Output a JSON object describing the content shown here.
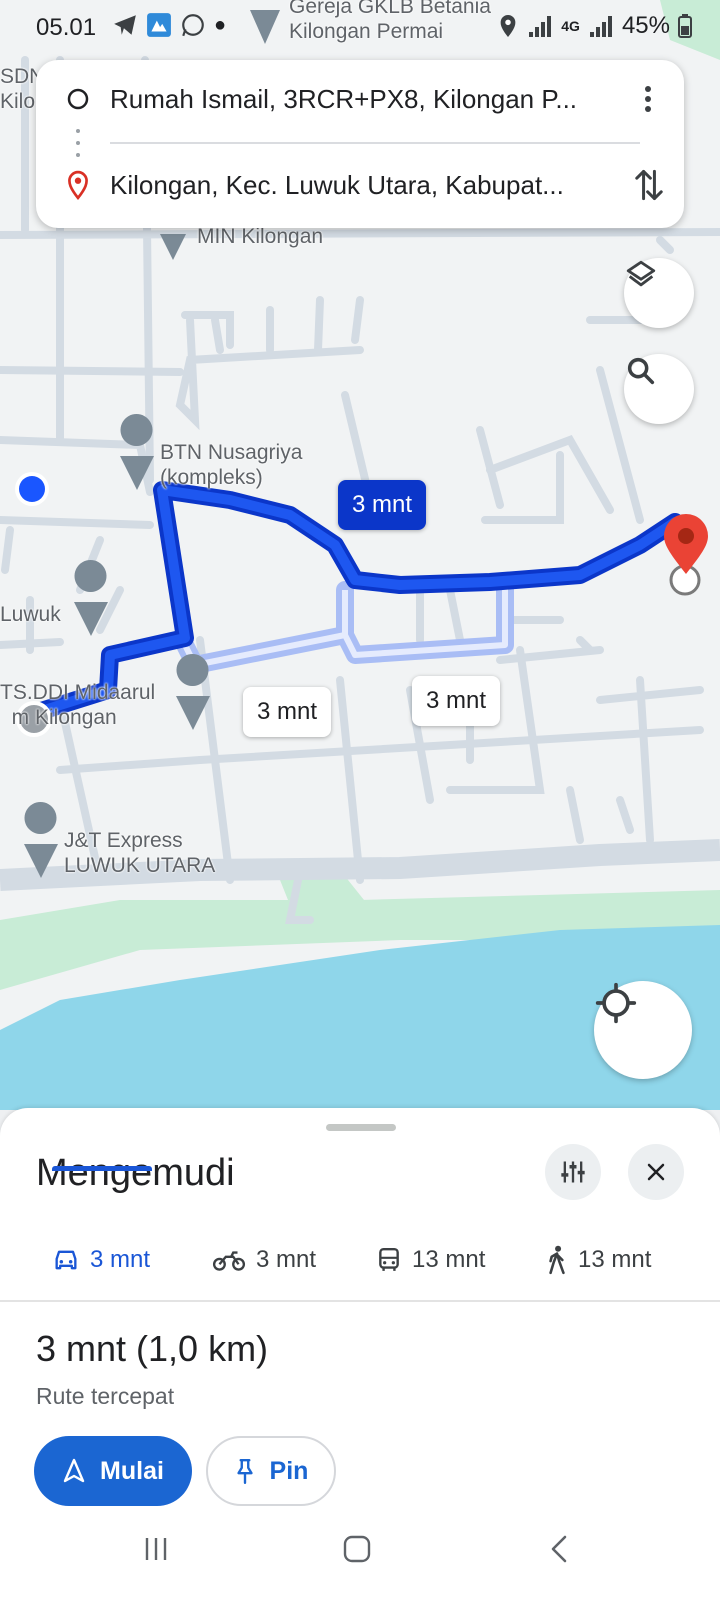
{
  "status_bar": {
    "time": "05.01",
    "network": "4G",
    "battery": "45%"
  },
  "directions": {
    "origin": "Rumah Ismail, 3RCR+PX8, Kilongan P...",
    "destination": "Kilongan, Kec. Luwuk Utara, Kabupat...",
    "more_icon": "more-vert-icon",
    "swap_icon": "swap-vert-icon"
  },
  "map": {
    "labels": {
      "church": "Gereja GKLB Betania\nKilongan Permai",
      "min": "MIN Kilongan",
      "sdn": "SDN\nKilon",
      "btn": "BTN Nusagriya\n(kompleks)",
      "luwuk": "Luwuk",
      "mts": "TS.DDI Midaarul\n  m Kilongan",
      "jnt": "J&T Express\nLUWUK UTARA"
    },
    "route_badges": {
      "primary": "3 mnt",
      "alt1": "3 mnt",
      "alt2": "3 mnt"
    },
    "layers_icon": "layers-icon",
    "search_icon": "search-icon",
    "locate_icon": "my-location-icon"
  },
  "sheet": {
    "title": "Mengemudi",
    "filter_icon": "tune-icon",
    "close_icon": "close-icon",
    "tabs": [
      {
        "icon": "car-icon",
        "label": "3 mnt",
        "active": true
      },
      {
        "icon": "motorcycle-icon",
        "label": "3 mnt",
        "active": false
      },
      {
        "icon": "transit-icon",
        "label": "13 mnt",
        "active": false
      },
      {
        "icon": "walk-icon",
        "label": "13 mnt",
        "active": false
      }
    ],
    "summary": "3 mnt (1,0 km)",
    "description": "Rute tercepat",
    "start_label": "Mulai",
    "pin_label": "Pin"
  },
  "colors": {
    "route_primary": "#0b36c9",
    "route_alt": "#a9bdf5",
    "water": "#8fd6ea",
    "accent": "#1b66d2"
  }
}
